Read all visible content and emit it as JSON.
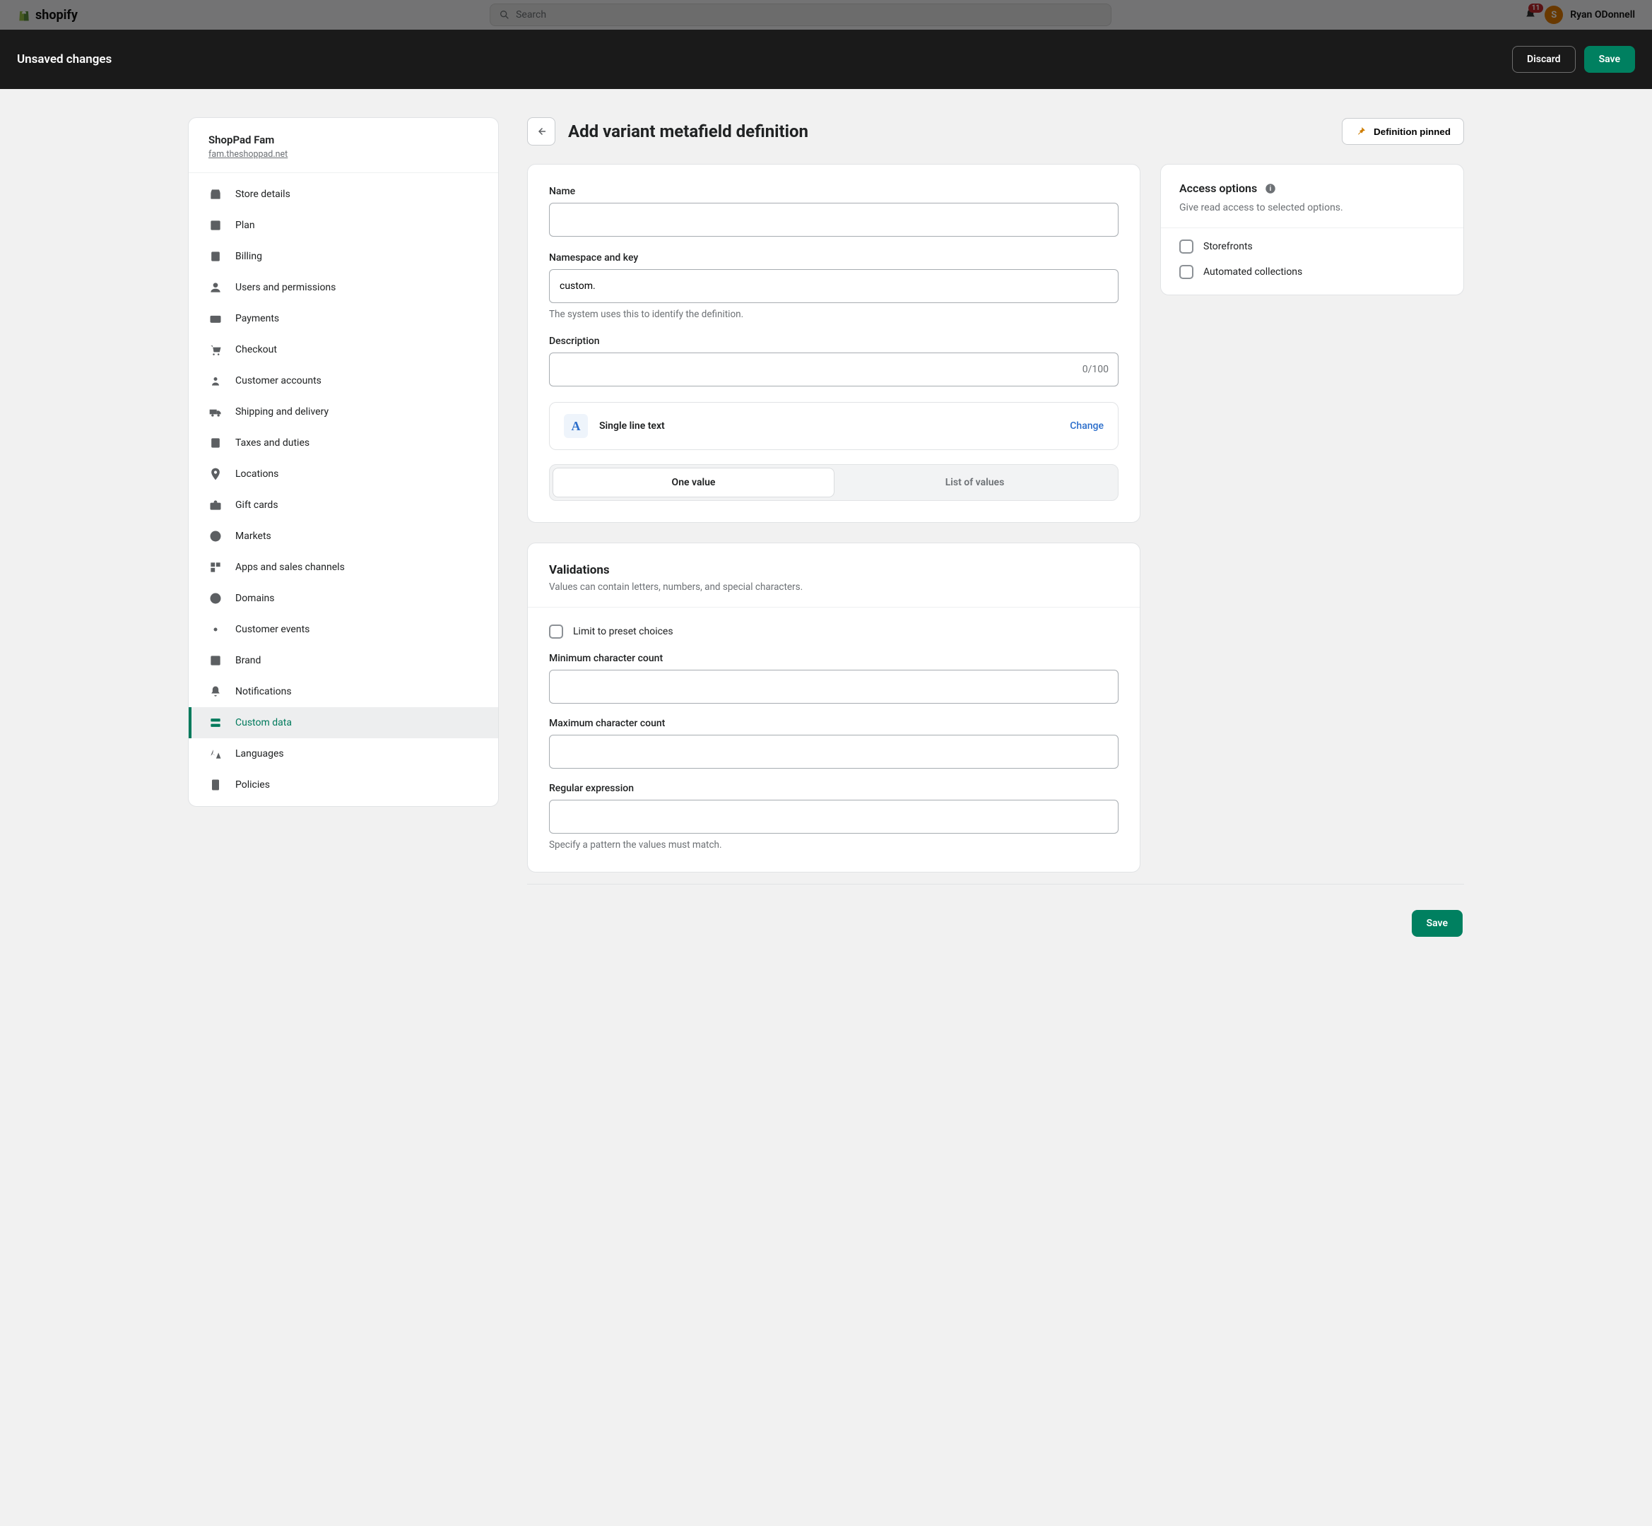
{
  "back": {
    "brand": "shopify",
    "search_placeholder": "Search",
    "notif_count": "11",
    "user_initial": "S",
    "user_name": "Ryan ODonnell"
  },
  "save_bar": {
    "title": "Unsaved changes",
    "discard": "Discard",
    "save": "Save"
  },
  "sidebar": {
    "store": "ShopPad Fam",
    "domain": "fam.theshoppad.net",
    "items": [
      {
        "label": "Store details"
      },
      {
        "label": "Plan"
      },
      {
        "label": "Billing"
      },
      {
        "label": "Users and permissions"
      },
      {
        "label": "Payments"
      },
      {
        "label": "Checkout"
      },
      {
        "label": "Customer accounts"
      },
      {
        "label": "Shipping and delivery"
      },
      {
        "label": "Taxes and duties"
      },
      {
        "label": "Locations"
      },
      {
        "label": "Gift cards"
      },
      {
        "label": "Markets"
      },
      {
        "label": "Apps and sales channels"
      },
      {
        "label": "Domains"
      },
      {
        "label": "Customer events"
      },
      {
        "label": "Brand"
      },
      {
        "label": "Notifications"
      },
      {
        "label": "Custom data"
      },
      {
        "label": "Languages"
      },
      {
        "label": "Policies"
      }
    ]
  },
  "header": {
    "title": "Add variant metafield definition",
    "pin_label": "Definition pinned"
  },
  "form": {
    "name_label": "Name",
    "name_value": "",
    "ns_label": "Namespace and key",
    "ns_value": "custom.",
    "ns_help": "The system uses this to identify the definition.",
    "desc_label": "Description",
    "desc_value": "",
    "desc_counter": "0/100",
    "type_name": "Single line text",
    "type_change": "Change",
    "seg_one": "One value",
    "seg_list": "List of values"
  },
  "access": {
    "title": "Access options",
    "sub": "Give read access to selected options.",
    "opt1": "Storefronts",
    "opt2": "Automated collections"
  },
  "validations": {
    "title": "Validations",
    "sub": "Values can contain letters, numbers, and special characters.",
    "preset_label": "Limit to preset choices",
    "min_label": "Minimum character count",
    "min_value": "",
    "max_label": "Maximum character count",
    "max_value": "",
    "regex_label": "Regular expression",
    "regex_value": "",
    "regex_help": "Specify a pattern the values must match."
  },
  "footer": {
    "save": "Save"
  }
}
